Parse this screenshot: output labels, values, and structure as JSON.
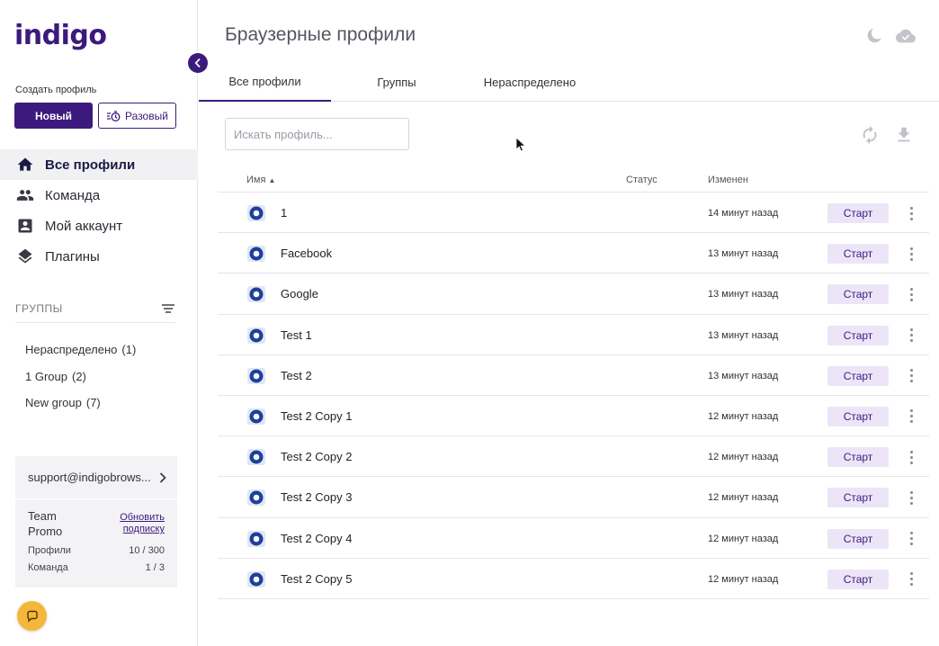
{
  "app": {
    "logo": "indigo",
    "title": "Браузерные профили"
  },
  "sidebar": {
    "create_label": "Создать профиль",
    "new_button": "Новый",
    "once_button": "Разовый",
    "nav": [
      {
        "label": "Все профили",
        "icon": "home-icon",
        "active": true
      },
      {
        "label": "Команда",
        "icon": "team-icon",
        "active": false
      },
      {
        "label": "Мой аккаунт",
        "icon": "account-icon",
        "active": false
      },
      {
        "label": "Плагины",
        "icon": "layers-icon",
        "active": false
      }
    ],
    "groups_title": "ГРУППЫ",
    "groups": [
      {
        "name": "Нераспределено",
        "count": "(1)"
      },
      {
        "name": "1 Group",
        "count": "(2)"
      },
      {
        "name": "New group",
        "count": "(7)"
      }
    ],
    "support_email": "support@indigobrows...",
    "plan_name": "Team Promo",
    "upgrade_link": "Обновить подписку",
    "stats": [
      {
        "label": "Профили",
        "value": "10 / 300"
      },
      {
        "label": "Команда",
        "value": "1 / 3"
      }
    ]
  },
  "tabs": [
    {
      "label": "Все профили",
      "active": true
    },
    {
      "label": "Группы",
      "active": false
    },
    {
      "label": "Нераспределено",
      "active": false
    }
  ],
  "search": {
    "placeholder": "Искать профиль..."
  },
  "table": {
    "columns": {
      "name": "Имя",
      "status": "Статус",
      "modified": "Изменен"
    },
    "start_label": "Старт",
    "rows": [
      {
        "name": "1",
        "modified": "14 минут назад",
        "status": ""
      },
      {
        "name": "Facebook",
        "modified": "13 минут назад",
        "status": ""
      },
      {
        "name": "Google",
        "modified": "13 минут назад",
        "status": ""
      },
      {
        "name": "Test 1",
        "modified": "13 минут назад",
        "status": ""
      },
      {
        "name": "Test 2",
        "modified": "13 минут назад",
        "status": ""
      },
      {
        "name": "Test 2 Copy 1",
        "modified": "12 минут назад",
        "status": ""
      },
      {
        "name": "Test 2 Copy 2",
        "modified": "12 минут назад",
        "status": ""
      },
      {
        "name": "Test 2 Copy 3",
        "modified": "12 минут назад",
        "status": ""
      },
      {
        "name": "Test 2 Copy 4",
        "modified": "12 минут назад",
        "status": ""
      },
      {
        "name": "Test 2 Copy 5",
        "modified": "12 минут назад",
        "status": ""
      }
    ]
  },
  "colors": {
    "accent": "#3c1a7d",
    "start_bg": "#ece5f7",
    "chat": "#f5b73b"
  }
}
